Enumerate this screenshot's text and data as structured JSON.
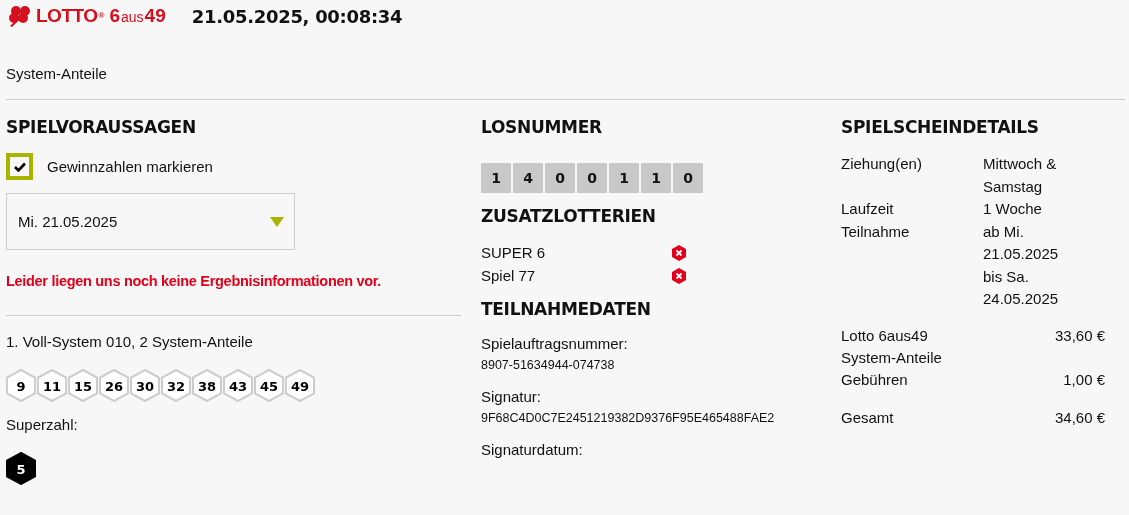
{
  "header": {
    "logo": {
      "brand": "LOTTO",
      "registered": "®",
      "game_number": "6",
      "game_word": "aus",
      "game_max": "49"
    },
    "timestamp": "21.05.2025, 00:08:34"
  },
  "page_title": "System-Anteile",
  "predictions": {
    "heading": "SPIELVORAUSSAGEN",
    "highlight_checkbox": {
      "label": "Gewinnzahlen markieren",
      "checked": true
    },
    "draw_select": {
      "value": "Mi. 21.05.2025"
    },
    "error_message": "Leider liegen uns noch keine Ergebnisinformationen vor.",
    "systems": [
      {
        "title": "1. Voll-System 010, 2 System-Anteile",
        "numbers": [
          "9",
          "11",
          "15",
          "26",
          "30",
          "32",
          "38",
          "43",
          "45",
          "49"
        ],
        "superzahl_label": "Superzahl:",
        "superzahl": "5"
      }
    ]
  },
  "ticket_number": {
    "heading": "LOSNUMMER",
    "digits": [
      "1",
      "4",
      "0",
      "0",
      "1",
      "1",
      "0"
    ]
  },
  "extra_lotteries": {
    "heading": "ZUSATZLOTTERIEN",
    "items": [
      {
        "name": "SUPER 6",
        "participating": false
      },
      {
        "name": "Spiel 77",
        "participating": false
      }
    ]
  },
  "participation": {
    "heading": "TEILNAHMEDATEN",
    "fields": [
      {
        "label": "Spielauftragsnummer:",
        "value": "8907-51634944-074738"
      },
      {
        "label": "Signatur:",
        "value": "9F68C4D0C7E2451219382D9376F95E465488FAE2"
      },
      {
        "label": "Signaturdatum:"
      }
    ]
  },
  "ticket_details": {
    "heading": "SPIELSCHEINDETAILS",
    "info": [
      {
        "label": "Ziehung(en)",
        "value": "Mittwoch & Samstag"
      },
      {
        "label": "Laufzeit",
        "value": "1 Woche"
      },
      {
        "label": "Teilnahme",
        "value": "ab Mi. 21.05.2025 bis Sa. 24.05.2025"
      }
    ],
    "costs": [
      {
        "label": "Lotto 6aus49 System-Anteile",
        "amount": "33,60 €"
      },
      {
        "label": "Gebühren",
        "amount": "1,00 €"
      }
    ],
    "total": {
      "label": "Gesamt",
      "amount": "34,60 €"
    }
  }
}
